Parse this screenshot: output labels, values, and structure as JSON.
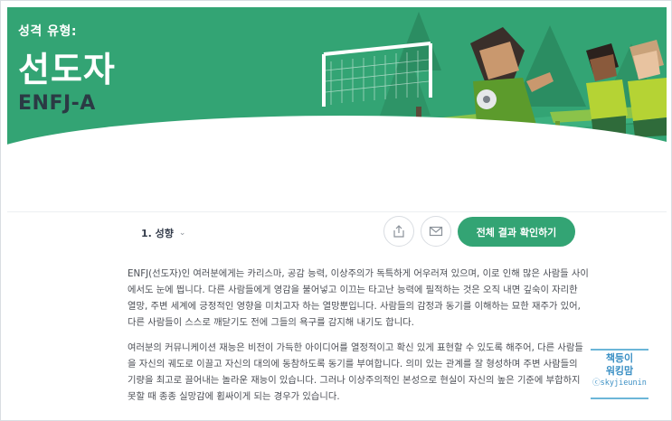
{
  "hero": {
    "label": "성격 유형:",
    "title": "선도자",
    "code": "ENFJ-A"
  },
  "toolbar": {
    "section_label": "1. 성향",
    "share_icon": "share-icon",
    "mail_icon": "mail-icon",
    "cta_label": "전체 결과 확인하기"
  },
  "content": {
    "paragraphs": [
      "ENFJ(선도자)인 여러분에게는 카리스마, 공감 능력, 이상주의가 독특하게 어우러져 있으며, 이로 인해 많은 사람들 사이에서도 눈에 띕니다. 다른 사람들에게 영감을 불어넣고 이끄는 타고난 능력에 필적하는 것은 오직 내면 깊숙이 자리한 열망, 주변 세계에 긍정적인 영향을 미치고자 하는 열망뿐입니다. 사람들의 감정과 동기를 이해하는 묘한 재주가 있어, 다른 사람들이 스스로 깨닫기도 전에 그들의 욕구를 감지해 내기도 합니다.",
      "여러분의 커뮤니케이션 재능은 비전이 가득한 아이디어를 열정적이고 확신 있게 표현할 수 있도록 해주어, 다른 사람들을 자신의 궤도로 이끌고 자신의 대의에 동참하도록 동기를 부여합니다. 의미 있는 관계를 잘 형성하며 주변 사람들의 기량을 최고로 끌어내는 놀라운 재능이 있습니다. 그러나 이상주의적인 본성으로 현실이 자신의 높은 기준에 부합하지 못할 때 종종 실망감에 휩싸이게 되는 경우가 있습니다."
    ]
  },
  "watermark": {
    "line1": "책등이",
    "line2": "워킹맘",
    "line3": "ⓒskyjieunin"
  },
  "colors": {
    "brand_green": "#33a474",
    "text": "#4c4f56",
    "dark": "#343c4b",
    "watermark_blue": "#3a8fc4"
  }
}
